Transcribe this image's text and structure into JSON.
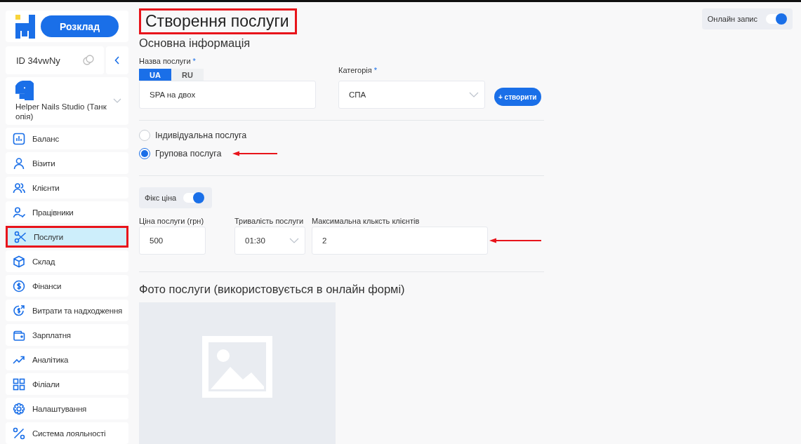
{
  "sidebar": {
    "schedule_button": "Розклад",
    "account_id": "ID 34vwNy",
    "studio": {
      "name": "Helper Nails Studio (Танкопія)"
    },
    "items": [
      {
        "label": "Баланс",
        "kind": "chart",
        "selected": false
      },
      {
        "label": "Візити",
        "kind": "person",
        "selected": false
      },
      {
        "label": "Клієнти",
        "kind": "people",
        "selected": false
      },
      {
        "label": "Працівники",
        "kind": "staff",
        "selected": false
      },
      {
        "label": "Послуги",
        "kind": "scissors",
        "selected": true
      },
      {
        "label": "Склад",
        "kind": "box",
        "selected": false
      },
      {
        "label": "Фінанси",
        "kind": "dollar",
        "selected": false
      },
      {
        "label": "Витрати та надходження",
        "kind": "exchange",
        "selected": false
      },
      {
        "label": "Зарплатня",
        "kind": "wallet",
        "selected": false
      },
      {
        "label": "Аналітика",
        "kind": "trend",
        "selected": false
      },
      {
        "label": "Філіали",
        "kind": "grid",
        "selected": false
      },
      {
        "label": "Налаштування",
        "kind": "gear",
        "selected": false
      },
      {
        "label": "Система лояльності",
        "kind": "percent",
        "selected": false
      }
    ]
  },
  "page_title": "Створення послуги",
  "online_booking": {
    "label": "Онлайн запис",
    "on": true
  },
  "basic_info": {
    "heading": "Основна інформація",
    "name": {
      "label": "Назва послуги",
      "required_mark": "*",
      "languages": [
        {
          "label": "UA",
          "selected": true
        },
        {
          "label": "RU",
          "selected": false
        }
      ],
      "value": "SPA на двох"
    },
    "category": {
      "label": "Категорія",
      "required_mark": "*",
      "value": "СПА"
    },
    "create_button": {
      "icon": "+",
      "label": "створити"
    }
  },
  "service_type": [
    {
      "label": "Індивідуальна послуга",
      "selected": false
    },
    {
      "label": "Групова послуга",
      "selected": true
    }
  ],
  "fixed_price": {
    "label": "Фікс ціна",
    "on": true
  },
  "price": {
    "label": "Ціна послуги (грн)",
    "value": "500"
  },
  "duration": {
    "label": "Тривалість послуги",
    "value": "01:30"
  },
  "max_clients": {
    "label": "Максимальна кльксть клієнтів",
    "value": "2"
  },
  "photo": {
    "heading": "Фото послуги (використовується в онлайн формі)"
  }
}
